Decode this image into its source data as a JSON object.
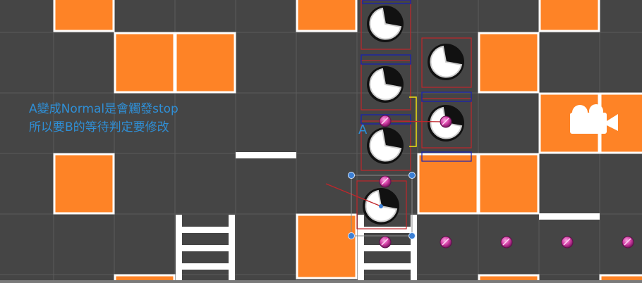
{
  "scene": {
    "annotation_lines": [
      "A變成Normal是會觸發stop",
      "所以要B的等待判定要修改"
    ],
    "actor_label": "A",
    "icons": [
      "pacman-sprite-icon",
      "waypoint-dot-icon",
      "camera-gizmo-icon",
      "transform-handle-icon",
      "ladder-tile"
    ]
  },
  "colors": {
    "background": "#454545",
    "tile": "#fe8326",
    "tile_border": "#ffffff",
    "grid": "#5a5a5a",
    "annotation": "#2f8fd6",
    "waypoint": "#d43fa6",
    "collider_red": "#c0262b",
    "collider_blue": "#1420b8",
    "bracket_yellow": "#f2e312"
  }
}
